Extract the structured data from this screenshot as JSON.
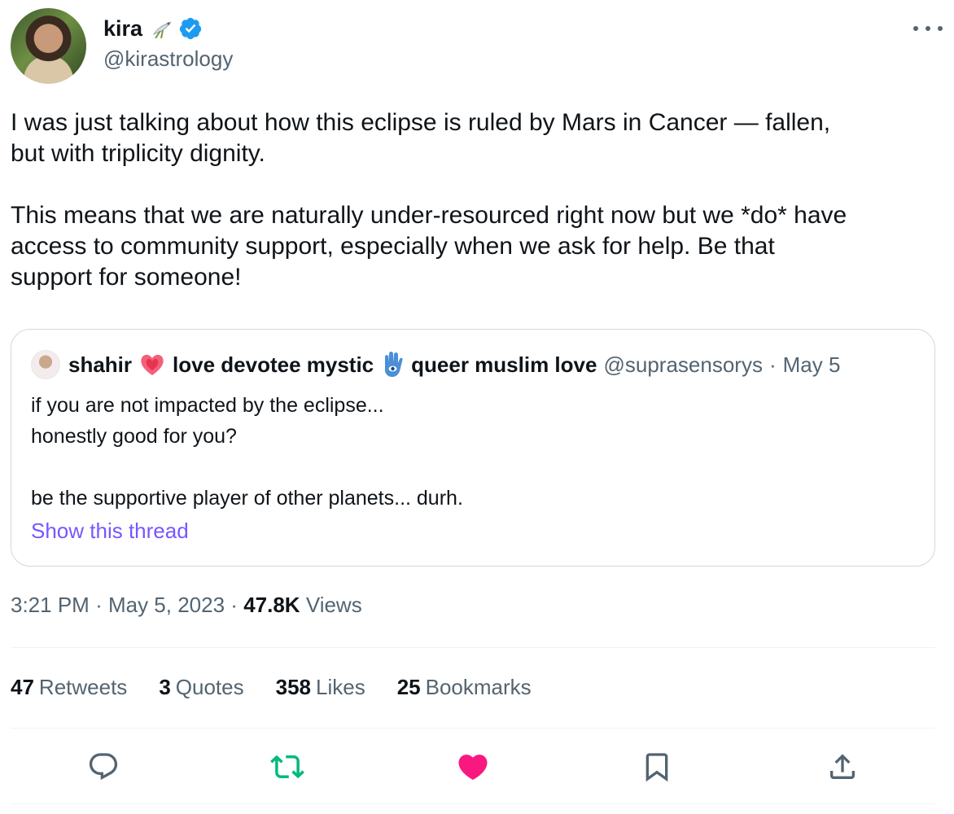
{
  "author": {
    "name": "kira",
    "handle": "@kirastrology"
  },
  "tweet": {
    "text": "I was just talking about how this eclipse is ruled by Mars in Cancer — fallen,\nbut with triplicity dignity.\n\nThis means that we are naturally under-resourced right now but we *do* have\naccess to community support, especially when we ask for help. Be that\nsupport for someone!"
  },
  "quote": {
    "name_part1": "shahir",
    "name_part2": "love devotee mystic",
    "name_part3": "queer muslim love",
    "handle": "@suprasensorys",
    "separator": "·",
    "date": "May 5",
    "text": "if you are not impacted by the eclipse...\nhonestly good for you?\n\nbe the supportive player of other planets... durh.",
    "show_thread": "Show this thread"
  },
  "meta": {
    "time": "3:21 PM",
    "date": "May 5, 2023",
    "separator": "·",
    "views_count": "47.8K",
    "views_label": "Views"
  },
  "stats": [
    {
      "count": "47",
      "label": "Retweets"
    },
    {
      "count": "3",
      "label": "Quotes"
    },
    {
      "count": "358",
      "label": "Likes"
    },
    {
      "count": "25",
      "label": "Bookmarks"
    }
  ],
  "icons": {
    "reply": "reply-icon",
    "retweet": "retweet-icon",
    "like": "like-icon",
    "bookmark": "bookmark-icon",
    "share": "share-icon",
    "more": "more-icon",
    "verified": "verified-badge-icon"
  },
  "colors": {
    "text": "#0f1419",
    "secondary": "#536471",
    "verified": "#1d9bf0",
    "retweet": "#00ba7c",
    "like": "#f91880",
    "link": "#7856ff",
    "border": "#cfd9de"
  }
}
